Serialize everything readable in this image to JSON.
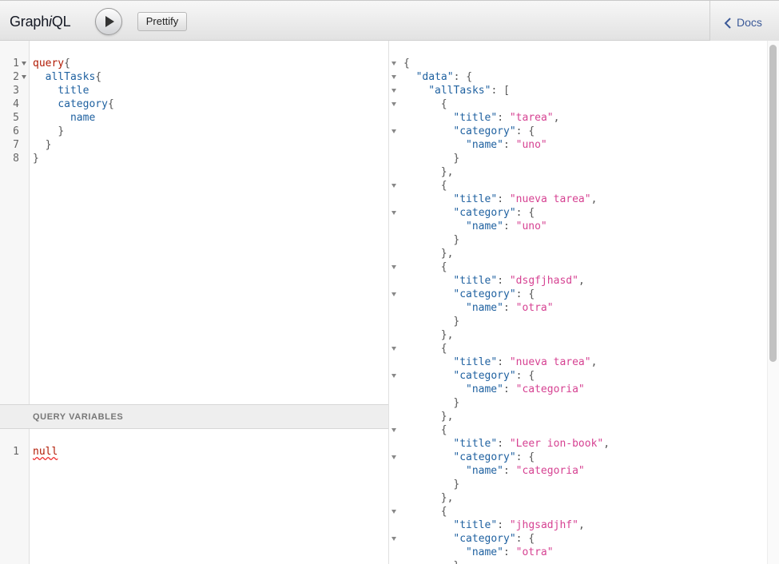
{
  "toolbar": {
    "title_prefix": "Graph",
    "title_italic": "i",
    "title_suffix": "QL",
    "prettify_label": "Prettify",
    "docs_label": "Docs"
  },
  "query_editor": {
    "lines": [
      {
        "num": "1",
        "fold": true
      },
      {
        "num": "2",
        "fold": true
      },
      {
        "num": "3",
        "fold": false
      },
      {
        "num": "4",
        "fold": false
      },
      {
        "num": "5",
        "fold": false
      },
      {
        "num": "6",
        "fold": false
      },
      {
        "num": "7",
        "fold": false
      },
      {
        "num": "8",
        "fold": false
      }
    ],
    "tokens": {
      "query_kw": "query",
      "alltasks": "allTasks",
      "title_field": "title",
      "category_field": "category",
      "name_field": "name",
      "open_brace": "{",
      "close_brace": "}"
    }
  },
  "variables": {
    "header": "QUERY VARIABLES",
    "line_number": "1",
    "value": "null"
  },
  "result": {
    "data_key": "\"data\"",
    "list_key": "\"allTasks\"",
    "title_key": "\"title\"",
    "category_key": "\"category\"",
    "name_key": "\"name\"",
    "tasks": [
      {
        "title": "\"tarea\"",
        "category": "\"uno\""
      },
      {
        "title": "\"nueva tarea\"",
        "category": "\"uno\""
      },
      {
        "title": "\"dsgfjhasd\"",
        "category": "\"otra\""
      },
      {
        "title": "\"nueva tarea\"",
        "category": "\"categoria\""
      },
      {
        "title": "\"Leer ion-book\"",
        "category": "\"categoria\""
      },
      {
        "title": "\"jhgsadjhf\"",
        "category": "\"otra\""
      }
    ]
  },
  "icons": {
    "execute": "play-icon",
    "docs": "chevron-left-icon"
  }
}
